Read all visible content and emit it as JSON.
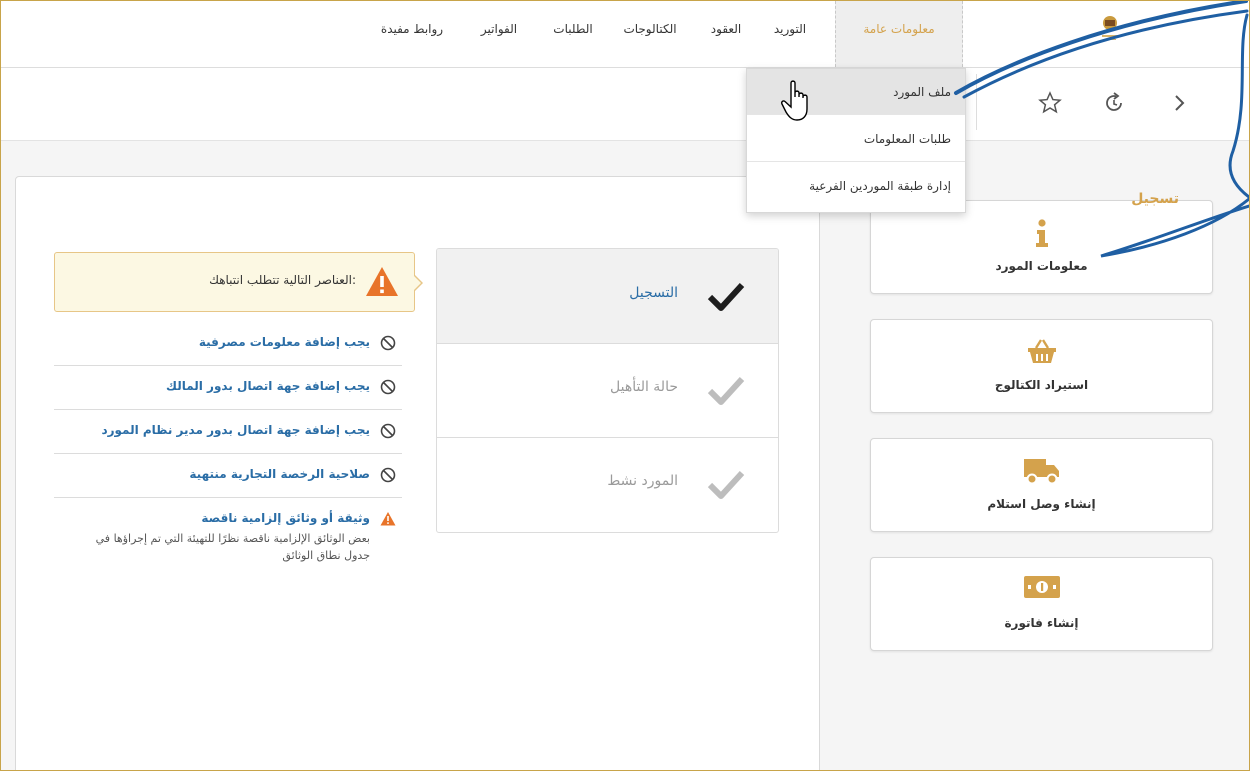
{
  "nav": {
    "items": [
      {
        "id": "general-info",
        "label": "معلومات عامة",
        "active": true
      },
      {
        "id": "supply",
        "label": "التوريد"
      },
      {
        "id": "contracts",
        "label": "العقود"
      },
      {
        "id": "catalogs",
        "label": "الكتالوجات"
      },
      {
        "id": "requests",
        "label": "الطلبات"
      },
      {
        "id": "invoices",
        "label": "الفواتير"
      },
      {
        "id": "useful-links",
        "label": "روابط مفيدة"
      }
    ]
  },
  "dropdown": {
    "items": [
      {
        "label": "ملف المورد",
        "hover": true
      },
      {
        "label": "طلبات المعلومات"
      },
      {
        "label": "إدارة طبقة الموردين الفرعية"
      }
    ]
  },
  "panel": {
    "title": "تسجيل"
  },
  "steps": [
    {
      "label": "التسجيل",
      "state": "done"
    },
    {
      "label": "حالة التأهيل",
      "state": "pending"
    },
    {
      "label": "المورد نشط",
      "state": "pending"
    }
  ],
  "warning": {
    "text": "العناصر التالية تتطلب انتباهك:"
  },
  "issues": [
    {
      "text": "يجب إضافة معلومات مصرفية",
      "icon": "ban-icon"
    },
    {
      "text": "يجب إضافة جهة اتصال بدور المالك",
      "icon": "ban-icon"
    },
    {
      "text": "يجب إضافة جهة اتصال بدور مدير نظام المورد",
      "icon": "ban-icon"
    },
    {
      "text": "صلاحية الرخصة التجارية منتهية",
      "icon": "ban-icon"
    },
    {
      "text": "وثيقة أو وثائق إلزامية ناقصة",
      "icon": "warning-icon",
      "desc": "بعض الوثائق الإلزامية ناقصة نظرًا للتهيئة التي تم إجراؤها في جدول نطاق الوثائق"
    }
  ],
  "tiles": [
    {
      "label": "معلومات المورد",
      "icon": "info-icon"
    },
    {
      "label": "استيراد الكتالوج",
      "icon": "basket-icon"
    },
    {
      "label": "إنشاء وصل استلام",
      "icon": "truck-icon"
    },
    {
      "label": "إنشاء فاتورة",
      "icon": "money-icon"
    }
  ],
  "colors": {
    "accent": "#d4a24c",
    "link": "#2a6da6",
    "warning": "#e8742a",
    "ink": "#1f5fa3"
  }
}
